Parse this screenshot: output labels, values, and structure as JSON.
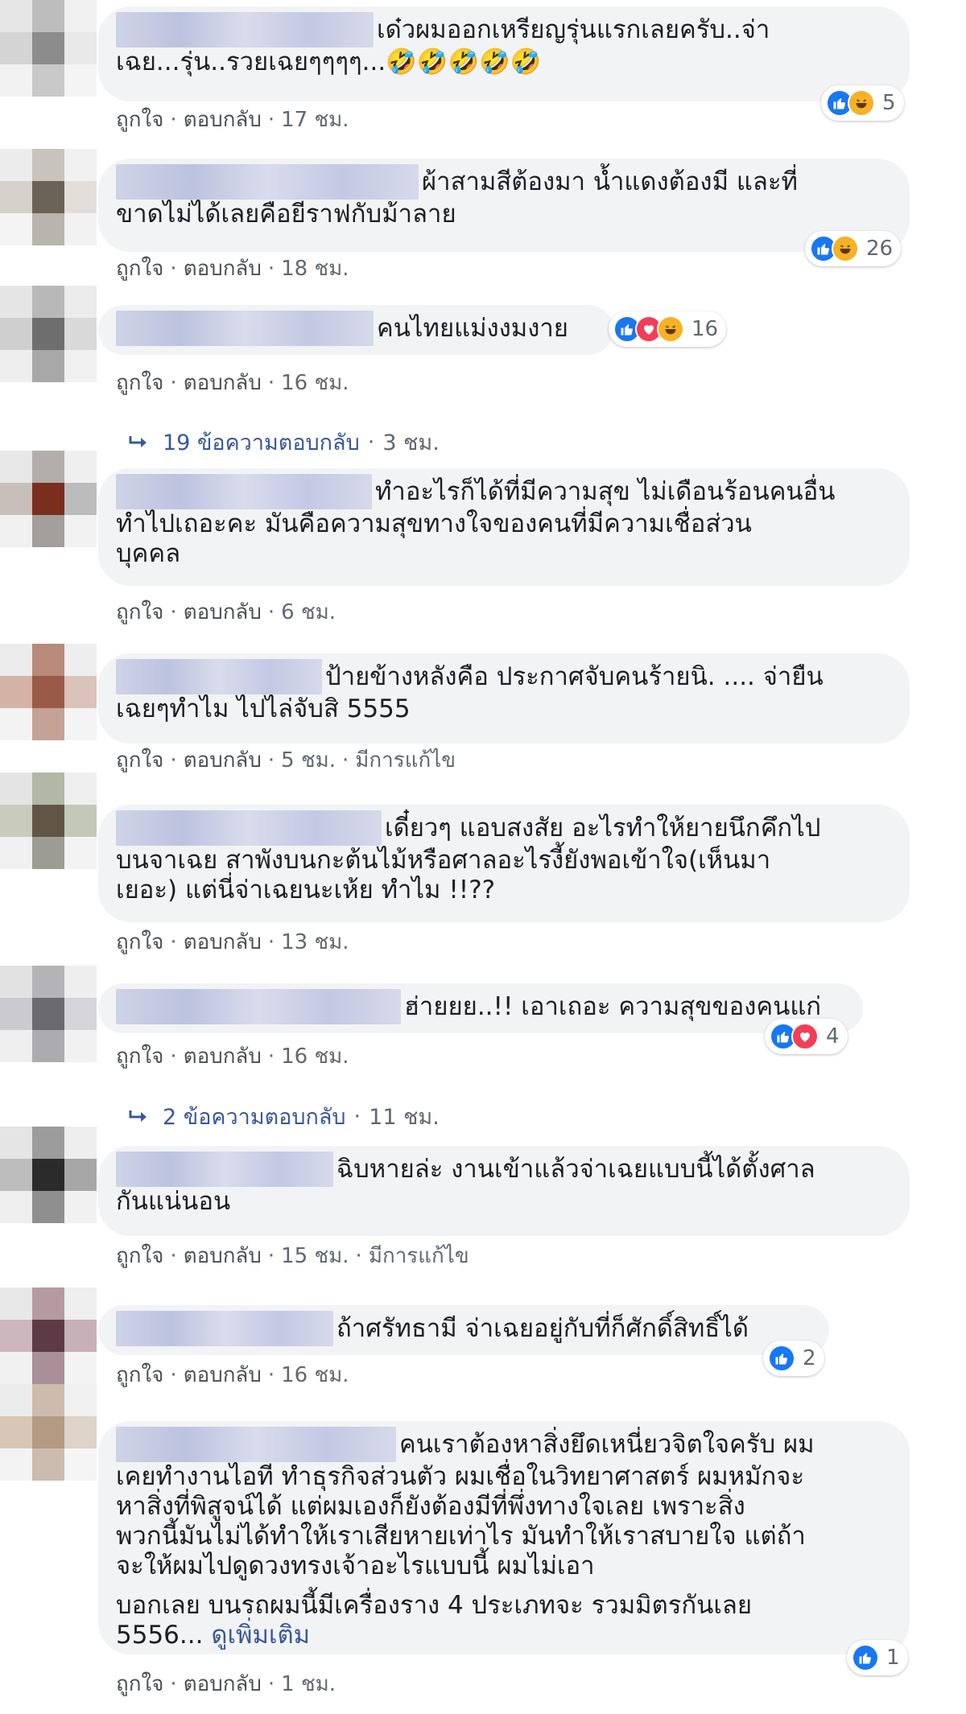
{
  "labels": {
    "like": "ถูกใจ",
    "reply": "ตอบกลับ",
    "edited": "มีการแก้ไข",
    "separator": "·"
  },
  "colors": {
    "bubble_bg": "#f2f3f5",
    "link": "#385898",
    "meta": "#606770",
    "like": "#1877f2",
    "love": "#f33e58",
    "haha": "#f7b125"
  },
  "comments": [
    {
      "text": "เด๋วผมออกเหรียญรุ่นแรกเลยครับ..จ่า\nเฉย...รุ่น..รวยเฉยๆๆๆๆ...🤣🤣🤣🤣🤣",
      "time": "17 ชม.",
      "reactions": [
        "like-icon",
        "haha-icon"
      ],
      "reaction_count": "5"
    },
    {
      "text": "ผ้าสามสีต้องมา น้ำแดงต้องมี และที่\nขาดไม่ได้เลยคือยีราฟกับม้าลาย",
      "time": "18 ชม.",
      "reactions": [
        "like-icon",
        "haha-icon"
      ],
      "reaction_count": "26"
    },
    {
      "text": "คนไทยแม่งงมงาย",
      "time": "16 ชม.",
      "reactions": [
        "like-icon",
        "love-icon",
        "haha-icon"
      ],
      "reaction_count": "16"
    },
    {
      "text": "ทำอะไรก็ได้ที่มีความสุข ไม่เดือนร้อนคนอื่น\nทำไปเถอะคะ มันคือความสุขทางใจของคนที่มีความเชื่อส่วน\nบุคคล",
      "time": "6 ชม."
    },
    {
      "text": "ป้ายข้างหลังคือ ประกาศจับคนร้ายนิ. .... จ่ายืน\nเฉยๆทำไม ไปไล่จับสิ 5555",
      "time": "5 ชม.",
      "edited": true
    },
    {
      "text": "เดี๋ยวๆ แอบสงสัย อะไรทำให้ยายนึกคึกไป\nบนจาเฉย สาพังบนกะต้นไม้หรือศาลอะไรงี้ยังพอเข้าใจ(เห็นมา\nเยอะ) แต่นี่จ่าเฉยนะเห้ย ทำไม !!??",
      "time": "13 ชม."
    },
    {
      "text": "ฮ่ายยย..!! เอาเถอะ ความสุขของคนแก่",
      "time": "16 ชม.",
      "reactions": [
        "like-icon",
        "love-icon"
      ],
      "reaction_count": "4"
    },
    {
      "text": "ฉิบหายล่ะ งานเข้าแล้วจ่าเฉยแบบนี้ได้ตั้งศาล\nกันแน่นอน",
      "time": "15 ชม.",
      "edited": true
    },
    {
      "text": "ถ้าศรัทธามี จ่าเฉยอยู่กับที่ก็ศักดิ์สิทธิ์ได้",
      "time": "16 ชม.",
      "reactions": [
        "like-icon"
      ],
      "reaction_count": "2"
    },
    {
      "text": "คนเราต้องหาสิ่งยึดเหนี่ยวจิตใจครับ ผม\nเคยทำงานไอที ทำธุรกิจส่วนตัว ผมเชื่อในวิทยาศาสตร์ ผมหมักจะ\nหาสิ่งที่พิสูจน์ได้ แต่ผมเองก็ยังต้องมีที่พึ่งทางใจเลย เพราะสิ่ง\nพวกนี้มันไม่ได้ทำให้เราเสียหายเท่าไร มันทำให้เราสบายใจ แต่ถ้า\nจะให้ผมไปดูดวงทรงเจ้าอะไรแบบนี้ ผมไม่เอา",
      "text2": "บอกเลย บนรถผมนี้มีเครื่องราง 4 ประเภทจะ รวมมิตรกันเลย\n5556...",
      "see_more": "ดูเพิ่มเติม",
      "time": "1 ชม.",
      "reactions": [
        "like-icon"
      ],
      "reaction_count": "1"
    }
  ],
  "reply_threads": [
    {
      "label": "19 ข้อความตอบกลับ",
      "time": "3 ชม."
    },
    {
      "label": "2 ข้อความตอบกลับ",
      "time": "11 ชม."
    }
  ]
}
